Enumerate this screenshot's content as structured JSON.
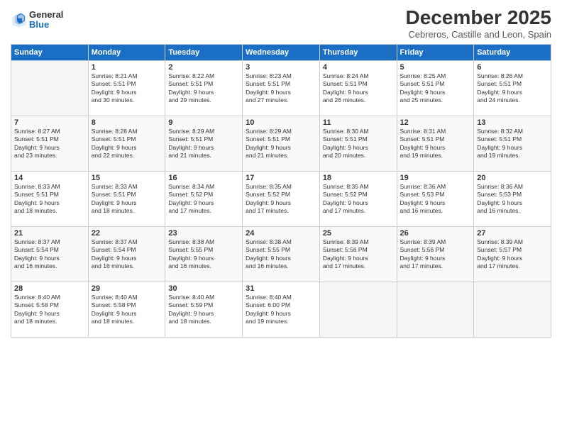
{
  "logo": {
    "general": "General",
    "blue": "Blue"
  },
  "header": {
    "title": "December 2025",
    "subtitle": "Cebreros, Castille and Leon, Spain"
  },
  "weekdays": [
    "Sunday",
    "Monday",
    "Tuesday",
    "Wednesday",
    "Thursday",
    "Friday",
    "Saturday"
  ],
  "weeks": [
    [
      {
        "day": "",
        "info": ""
      },
      {
        "day": "1",
        "info": "Sunrise: 8:21 AM\nSunset: 5:51 PM\nDaylight: 9 hours\nand 30 minutes."
      },
      {
        "day": "2",
        "info": "Sunrise: 8:22 AM\nSunset: 5:51 PM\nDaylight: 9 hours\nand 29 minutes."
      },
      {
        "day": "3",
        "info": "Sunrise: 8:23 AM\nSunset: 5:51 PM\nDaylight: 9 hours\nand 27 minutes."
      },
      {
        "day": "4",
        "info": "Sunrise: 8:24 AM\nSunset: 5:51 PM\nDaylight: 9 hours\nand 26 minutes."
      },
      {
        "day": "5",
        "info": "Sunrise: 8:25 AM\nSunset: 5:51 PM\nDaylight: 9 hours\nand 25 minutes."
      },
      {
        "day": "6",
        "info": "Sunrise: 8:26 AM\nSunset: 5:51 PM\nDaylight: 9 hours\nand 24 minutes."
      }
    ],
    [
      {
        "day": "7",
        "info": "Sunrise: 8:27 AM\nSunset: 5:51 PM\nDaylight: 9 hours\nand 23 minutes."
      },
      {
        "day": "8",
        "info": "Sunrise: 8:28 AM\nSunset: 5:51 PM\nDaylight: 9 hours\nand 22 minutes."
      },
      {
        "day": "9",
        "info": "Sunrise: 8:29 AM\nSunset: 5:51 PM\nDaylight: 9 hours\nand 21 minutes."
      },
      {
        "day": "10",
        "info": "Sunrise: 8:29 AM\nSunset: 5:51 PM\nDaylight: 9 hours\nand 21 minutes."
      },
      {
        "day": "11",
        "info": "Sunrise: 8:30 AM\nSunset: 5:51 PM\nDaylight: 9 hours\nand 20 minutes."
      },
      {
        "day": "12",
        "info": "Sunrise: 8:31 AM\nSunset: 5:51 PM\nDaylight: 9 hours\nand 19 minutes."
      },
      {
        "day": "13",
        "info": "Sunrise: 8:32 AM\nSunset: 5:51 PM\nDaylight: 9 hours\nand 19 minutes."
      }
    ],
    [
      {
        "day": "14",
        "info": "Sunrise: 8:33 AM\nSunset: 5:51 PM\nDaylight: 9 hours\nand 18 minutes."
      },
      {
        "day": "15",
        "info": "Sunrise: 8:33 AM\nSunset: 5:51 PM\nDaylight: 9 hours\nand 18 minutes."
      },
      {
        "day": "16",
        "info": "Sunrise: 8:34 AM\nSunset: 5:52 PM\nDaylight: 9 hours\nand 17 minutes."
      },
      {
        "day": "17",
        "info": "Sunrise: 8:35 AM\nSunset: 5:52 PM\nDaylight: 9 hours\nand 17 minutes."
      },
      {
        "day": "18",
        "info": "Sunrise: 8:35 AM\nSunset: 5:52 PM\nDaylight: 9 hours\nand 17 minutes."
      },
      {
        "day": "19",
        "info": "Sunrise: 8:36 AM\nSunset: 5:53 PM\nDaylight: 9 hours\nand 16 minutes."
      },
      {
        "day": "20",
        "info": "Sunrise: 8:36 AM\nSunset: 5:53 PM\nDaylight: 9 hours\nand 16 minutes."
      }
    ],
    [
      {
        "day": "21",
        "info": "Sunrise: 8:37 AM\nSunset: 5:54 PM\nDaylight: 9 hours\nand 16 minutes."
      },
      {
        "day": "22",
        "info": "Sunrise: 8:37 AM\nSunset: 5:54 PM\nDaylight: 9 hours\nand 16 minutes."
      },
      {
        "day": "23",
        "info": "Sunrise: 8:38 AM\nSunset: 5:55 PM\nDaylight: 9 hours\nand 16 minutes."
      },
      {
        "day": "24",
        "info": "Sunrise: 8:38 AM\nSunset: 5:55 PM\nDaylight: 9 hours\nand 16 minutes."
      },
      {
        "day": "25",
        "info": "Sunrise: 8:39 AM\nSunset: 5:56 PM\nDaylight: 9 hours\nand 17 minutes."
      },
      {
        "day": "26",
        "info": "Sunrise: 8:39 AM\nSunset: 5:56 PM\nDaylight: 9 hours\nand 17 minutes."
      },
      {
        "day": "27",
        "info": "Sunrise: 8:39 AM\nSunset: 5:57 PM\nDaylight: 9 hours\nand 17 minutes."
      }
    ],
    [
      {
        "day": "28",
        "info": "Sunrise: 8:40 AM\nSunset: 5:58 PM\nDaylight: 9 hours\nand 18 minutes."
      },
      {
        "day": "29",
        "info": "Sunrise: 8:40 AM\nSunset: 5:58 PM\nDaylight: 9 hours\nand 18 minutes."
      },
      {
        "day": "30",
        "info": "Sunrise: 8:40 AM\nSunset: 5:59 PM\nDaylight: 9 hours\nand 18 minutes."
      },
      {
        "day": "31",
        "info": "Sunrise: 8:40 AM\nSunset: 6:00 PM\nDaylight: 9 hours\nand 19 minutes."
      },
      {
        "day": "",
        "info": ""
      },
      {
        "day": "",
        "info": ""
      },
      {
        "day": "",
        "info": ""
      }
    ]
  ]
}
